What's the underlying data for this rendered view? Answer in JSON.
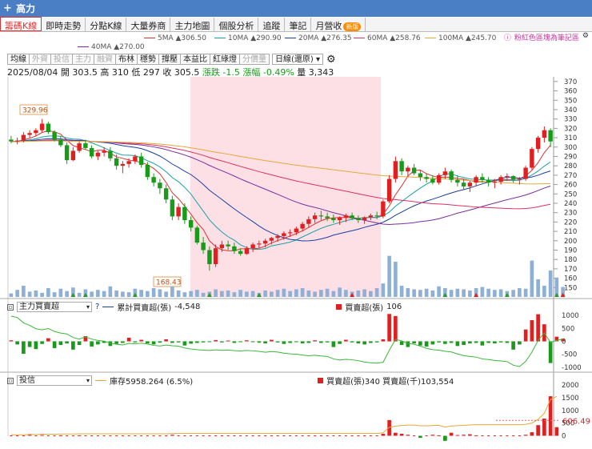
{
  "window": {
    "title": "高力"
  },
  "tabs": [
    {
      "label": "籌碼K線",
      "active": true
    },
    {
      "label": "即時走勢"
    },
    {
      "label": "分點K線"
    },
    {
      "label": "大量券商"
    },
    {
      "label": "主力地圖"
    },
    {
      "label": "個股分析"
    },
    {
      "label": "追蹤"
    },
    {
      "label": "筆記"
    },
    {
      "label": "月營收",
      "badge": "新版"
    }
  ],
  "ma_legend": [
    {
      "label": "5MA ▲306.50",
      "color": "#e03030"
    },
    {
      "label": "10MA ▲290.90",
      "color": "#19a0a0"
    },
    {
      "label": "20MA ▲276.35",
      "color": "#1a3fa0"
    },
    {
      "label": "60MA ▲258.76",
      "color": "#e03060"
    },
    {
      "label": "100MA ▲245.70",
      "color": "#e8a838"
    },
    {
      "label": "40MA ▲270.00",
      "color": "#7a2e9a"
    }
  ],
  "right_link": "粉紅色區塊為筆記區",
  "toolbar": {
    "buttons": [
      {
        "label": "均線",
        "enabled": true
      },
      {
        "label": "外資",
        "enabled": false
      },
      {
        "label": "投信",
        "enabled": false
      },
      {
        "label": "主力",
        "enabled": false
      },
      {
        "label": "融資",
        "enabled": false
      },
      {
        "label": "布林",
        "enabled": true
      },
      {
        "label": "穩勢",
        "enabled": true
      },
      {
        "label": "撐壓",
        "enabled": true
      },
      {
        "label": "本益比",
        "enabled": true
      },
      {
        "label": "紅綠燈",
        "enabled": true
      },
      {
        "label": "分價量",
        "enabled": false
      }
    ],
    "period_select": "日線(還原)"
  },
  "quote": {
    "date": "2025/08/04",
    "open": "開 303.5",
    "high": "高 310",
    "low": "低 297",
    "close": "收 305.5",
    "change": "漲跌 -1.5",
    "change_pct": "漲幅 -0.49%",
    "volume": "量 3,343"
  },
  "colors": {
    "up": "#e02020",
    "down": "#1a9a1a",
    "note_band": "#fde0e6",
    "volume": "#8eb0d6"
  },
  "chart_data": [
    {
      "type": "candlestick",
      "title": "",
      "ylim": [
        140,
        375
      ],
      "y_ticks": [
        "370",
        "360",
        "350",
        "340",
        "330",
        "320",
        "310",
        "300",
        "290",
        "280",
        "270",
        "260",
        "250",
        "240",
        "230",
        "220",
        "210",
        "200",
        "190",
        "180",
        "170",
        "160",
        "150"
      ],
      "annotations": [
        "329.96",
        "168.43"
      ],
      "candles": [
        [
          308,
          312,
          304,
          306
        ],
        [
          306,
          310,
          303,
          307
        ],
        [
          307,
          316,
          305,
          313
        ],
        [
          313,
          318,
          310,
          315
        ],
        [
          315,
          320,
          312,
          318
        ],
        [
          318,
          330,
          316,
          325
        ],
        [
          325,
          327,
          314,
          316
        ],
        [
          316,
          318,
          306,
          308
        ],
        [
          308,
          312,
          300,
          302
        ],
        [
          302,
          305,
          282,
          286
        ],
        [
          286,
          300,
          285,
          296
        ],
        [
          296,
          306,
          294,
          304
        ],
        [
          304,
          308,
          297,
          299
        ],
        [
          299,
          302,
          288,
          290
        ],
        [
          290,
          296,
          286,
          294
        ],
        [
          294,
          300,
          290,
          296
        ],
        [
          296,
          300,
          285,
          288
        ],
        [
          288,
          292,
          276,
          280
        ],
        [
          280,
          285,
          272,
          282
        ],
        [
          282,
          288,
          278,
          285
        ],
        [
          285,
          292,
          282,
          290
        ],
        [
          290,
          294,
          278,
          281
        ],
        [
          281,
          284,
          265,
          268
        ],
        [
          268,
          272,
          258,
          262
        ],
        [
          262,
          266,
          250,
          256
        ],
        [
          256,
          260,
          240,
          244
        ],
        [
          244,
          248,
          222,
          226
        ],
        [
          226,
          240,
          222,
          236
        ],
        [
          236,
          240,
          218,
          222
        ],
        [
          222,
          226,
          210,
          214
        ],
        [
          214,
          216,
          196,
          198
        ],
        [
          198,
          204,
          186,
          190
        ],
        [
          190,
          194,
          168,
          175
        ],
        [
          175,
          196,
          172,
          192
        ],
        [
          192,
          200,
          188,
          196
        ],
        [
          196,
          200,
          190,
          194
        ],
        [
          194,
          198,
          186,
          189
        ],
        [
          189,
          192,
          184,
          186
        ],
        [
          186,
          194,
          185,
          192
        ],
        [
          192,
          198,
          188,
          196
        ],
        [
          196,
          200,
          192,
          197
        ],
        [
          197,
          202,
          193,
          200
        ],
        [
          200,
          204,
          196,
          203
        ],
        [
          203,
          207,
          199,
          205
        ],
        [
          205,
          210,
          201,
          208
        ],
        [
          208,
          212,
          204,
          209
        ],
        [
          209,
          215,
          206,
          213
        ],
        [
          213,
          220,
          210,
          218
        ],
        [
          218,
          226,
          214,
          223
        ],
        [
          223,
          230,
          219,
          227
        ],
        [
          227,
          232,
          222,
          226
        ],
        [
          226,
          230,
          221,
          224
        ],
        [
          224,
          228,
          219,
          222
        ],
        [
          222,
          226,
          217,
          225
        ],
        [
          225,
          229,
          220,
          227
        ],
        [
          227,
          230,
          222,
          224
        ],
        [
          224,
          227,
          219,
          222
        ],
        [
          222,
          226,
          218,
          225
        ],
        [
          225,
          229,
          222,
          227
        ],
        [
          227,
          231,
          223,
          226
        ],
        [
          226,
          244,
          224,
          242
        ],
        [
          242,
          270,
          240,
          266
        ],
        [
          266,
          290,
          262,
          285
        ],
        [
          285,
          288,
          270,
          274
        ],
        [
          274,
          280,
          268,
          278
        ],
        [
          278,
          282,
          270,
          272
        ],
        [
          272,
          275,
          264,
          268
        ],
        [
          268,
          272,
          262,
          266
        ],
        [
          266,
          270,
          260,
          262
        ],
        [
          262,
          272,
          260,
          270
        ],
        [
          270,
          278,
          266,
          274
        ],
        [
          274,
          276,
          262,
          265
        ],
        [
          265,
          270,
          258,
          262
        ],
        [
          262,
          266,
          254,
          258
        ],
        [
          258,
          264,
          252,
          262
        ],
        [
          262,
          270,
          258,
          268
        ],
        [
          268,
          272,
          262,
          265
        ],
        [
          265,
          268,
          258,
          262
        ],
        [
          262,
          266,
          256,
          263
        ],
        [
          263,
          270,
          260,
          268
        ],
        [
          268,
          272,
          264,
          269
        ],
        [
          269,
          270,
          262,
          265
        ],
        [
          265,
          268,
          260,
          266
        ],
        [
          266,
          280,
          264,
          278
        ],
        [
          278,
          300,
          276,
          298
        ],
        [
          298,
          312,
          294,
          310
        ],
        [
          310,
          322,
          305,
          318
        ],
        [
          318,
          320,
          300,
          306
        ]
      ],
      "volume": [
        12,
        24,
        38,
        18,
        22,
        14,
        30,
        16,
        28,
        20,
        32,
        14,
        26,
        18,
        24,
        20,
        36,
        22,
        18,
        16,
        28,
        24,
        20,
        30,
        26,
        18,
        34,
        22,
        16,
        20,
        24,
        14,
        18,
        26,
        20,
        22,
        16,
        24,
        18,
        20,
        14,
        22,
        18,
        24,
        28,
        20,
        26,
        30,
        22,
        18,
        24,
        28,
        20,
        32,
        24,
        18,
        22,
        26,
        20,
        30,
        46,
        140,
        120,
        38,
        30,
        26,
        24,
        28,
        22,
        36,
        30,
        24,
        28,
        26,
        22,
        30,
        34,
        28,
        24,
        26,
        20,
        24,
        30,
        28,
        124,
        60,
        38,
        90,
        66,
        34
      ]
    },
    {
      "type": "bar",
      "title": "主力買賣超",
      "series": [
        {
          "name": "累計買賣超(張)",
          "value": "-4,548"
        },
        {
          "name": "買賣超(張)",
          "value": "106"
        }
      ],
      "ylim": [
        -1100,
        1100
      ],
      "y_ticks": [
        "1000",
        "500",
        "0",
        "-500",
        "-1000"
      ],
      "values": [
        40,
        -120,
        -480,
        -220,
        -300,
        -100,
        120,
        -260,
        -140,
        -80,
        -320,
        -140,
        200,
        -200,
        -120,
        -60,
        -180,
        -100,
        -60,
        140,
        -40,
        60,
        -80,
        -120,
        -50,
        80,
        -60,
        -40,
        -160,
        -90,
        -60,
        -40,
        -30,
        50,
        -40,
        30,
        -60,
        -20,
        40,
        -30,
        -50,
        -80,
        60,
        -40,
        -100,
        -60,
        -30,
        -80,
        -60,
        40,
        -60,
        -40,
        -220,
        -100,
        60,
        -40,
        -80,
        -120,
        -60,
        -40,
        80,
        1060,
        980,
        -140,
        -220,
        -80,
        -160,
        -200,
        -120,
        -40,
        -100,
        -60,
        -180,
        -140,
        -80,
        -60,
        -160,
        -60,
        -80,
        -40,
        -60,
        -320,
        -120,
        460,
        820,
        1050,
        660,
        -840,
        180,
        106
      ],
      "cumulative_trend": "declining"
    },
    {
      "type": "bar",
      "title": "投信",
      "series": [
        {
          "name": "庫存5958.264 (6.5%)"
        },
        {
          "name": "買賣超(張)340 買賣超(千)103,554"
        }
      ],
      "ylim": [
        -300,
        2100
      ],
      "y_ticks": [
        "2000",
        "1500",
        "1000",
        "500",
        "0"
      ],
      "highlight_label": "606.49",
      "values": [
        0,
        0,
        0,
        40,
        0,
        30,
        0,
        0,
        20,
        0,
        0,
        20,
        0,
        0,
        0,
        0,
        0,
        0,
        0,
        0,
        0,
        0,
        0,
        0,
        0,
        0,
        40,
        0,
        0,
        0,
        0,
        0,
        0,
        0,
        0,
        0,
        0,
        0,
        0,
        0,
        0,
        0,
        0,
        0,
        0,
        0,
        0,
        0,
        0,
        0,
        0,
        0,
        0,
        0,
        0,
        0,
        0,
        0,
        0,
        0,
        80,
        620,
        120,
        80,
        40,
        0,
        -80,
        0,
        40,
        20,
        -200,
        120,
        30,
        40,
        60,
        20,
        0,
        0,
        0,
        0,
        0,
        0,
        0,
        40,
        140,
        420,
        680,
        1560,
        340
      ]
    }
  ]
}
